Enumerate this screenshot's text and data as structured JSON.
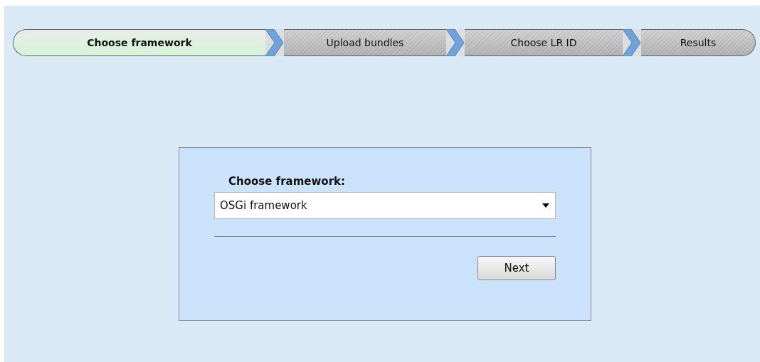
{
  "steps": [
    {
      "label": "Choose framework",
      "selected": true
    },
    {
      "label": "Upload bundles",
      "selected": false
    },
    {
      "label": "Choose LR ID",
      "selected": false
    },
    {
      "label": "Results",
      "selected": false
    }
  ],
  "form": {
    "label": "Choose framework:",
    "select": {
      "value": "OSGi framework"
    },
    "button": "Next"
  }
}
